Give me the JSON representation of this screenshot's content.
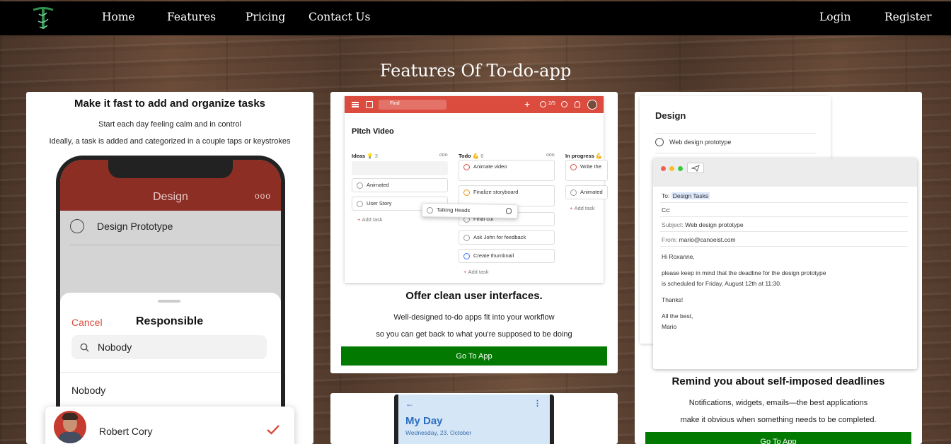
{
  "nav": {
    "links": [
      "Home",
      "Features",
      "Pricing",
      "Contact Us"
    ],
    "login": "Login",
    "register": "Register"
  },
  "page_title": "Features Of To-do-app",
  "cards": [
    {
      "title": "Make it fast to add and organize tasks",
      "line1": "Start each day feeling calm and in control",
      "line2": "Ideally, a task is added and categorized in a couple taps or keystrokes",
      "phone": {
        "header": "Design",
        "header_more": "ooo",
        "task": "Design Prototype",
        "cancel": "Cancel",
        "sheet_title": "Responsible",
        "search_value": "Nobody",
        "option1": "Nobody",
        "option2": "Robert Cory"
      }
    },
    {
      "title": "Offer clean user interfaces.",
      "line1": "Well-designed to-do apps fit into your workflow",
      "line2": "so you can get back to what you're supposed to be doing",
      "button": "Go To App",
      "kanban": {
        "search": "Find",
        "badge": "2/5",
        "project": "Pitch Video",
        "columns": [
          {
            "name": "Ideas 💡",
            "count": "3"
          },
          {
            "name": "Todo 💪",
            "count": "6"
          },
          {
            "name": "In progress 💪"
          }
        ],
        "ideas": [
          "Animated",
          "User Story"
        ],
        "todo": [
          "Animate video",
          "Finalize storyboard",
          "Final cut",
          "Ask John for feedback",
          "Create thumbnail"
        ],
        "progress": [
          "Write the",
          "Animated"
        ],
        "dragging": "Talking Heads",
        "add_task": "Add task"
      }
    },
    {
      "title": "Remind you about self-imposed deadlines",
      "line1": "Notifications, widgets, emails—the best applications",
      "line2": "make it obvious when something needs to be completed.",
      "button": "Go To App",
      "design_panel": {
        "title": "Design",
        "task": "Web design prototype"
      },
      "email": {
        "to_label": "To:",
        "to_value": "Design Tasks",
        "cc_label": "Cc:",
        "subject_label": "Subject:",
        "subject_value": "Web design prototype",
        "from_label": "From:",
        "from_value": "mario@canoeist.com",
        "greeting": "Hi Roxanne,",
        "body1": "please keep in mind that the deadline for the design prototype",
        "body2": "is scheduled for Friday, August 12th at 11:30.",
        "thanks": "Thanks!",
        "sign1": "All the best,",
        "sign2": "Mario"
      }
    },
    {
      "phone": {
        "title": "My Day",
        "date": "Wednesday, 23. October"
      }
    }
  ]
}
